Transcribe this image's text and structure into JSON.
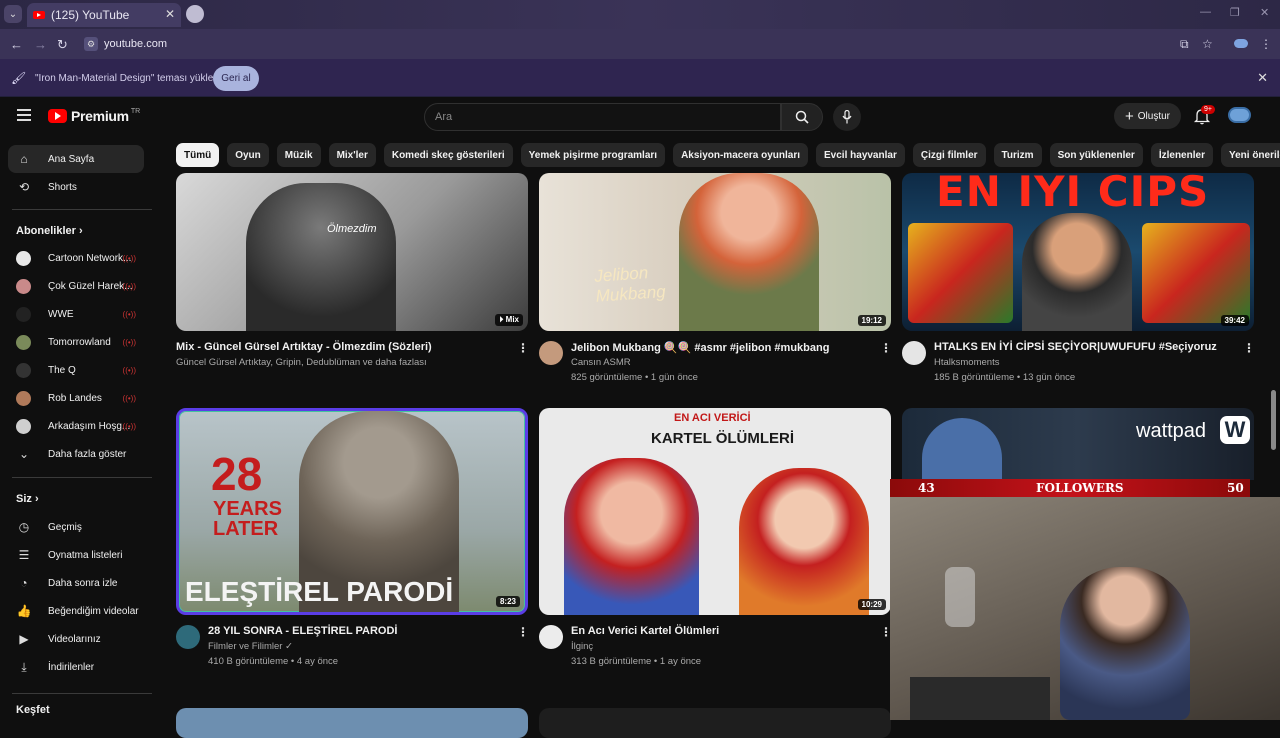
{
  "browser": {
    "tab_title": "(125) YouTube",
    "url": "youtube.com"
  },
  "theme_bar": {
    "message": "\"Iron Man-Material Design\" teması yüklendi",
    "undo_label": "Geri al"
  },
  "masthead": {
    "logo_text": "Premium",
    "logo_superscript": "TR",
    "search_placeholder": "Ara",
    "create_label": "Oluştur",
    "notification_count": "9+"
  },
  "chips": [
    "Tümü",
    "Oyun",
    "Müzik",
    "Mix'ler",
    "Komedi skeç gösterileri",
    "Yemek pişirme programları",
    "Aksiyon-macera oyunları",
    "Evcil hayvanlar",
    "Çizgi filmler",
    "Turizm",
    "Son yüklenenler",
    "İzlenenler",
    "Yeni öneriler"
  ],
  "sidebar": {
    "home": "Ana Sayfa",
    "shorts": "Shorts",
    "subscriptions_header": "Abonelikler",
    "subscriptions": [
      {
        "name": "Cartoon Network...",
        "color": "#e8e8e8"
      },
      {
        "name": "Çok Güzel Harek...",
        "color": "#c98a8a"
      },
      {
        "name": "WWE",
        "color": "#222222"
      },
      {
        "name": "Tomorrowland",
        "color": "#7a8a5a"
      },
      {
        "name": "The Q",
        "color": "#333333"
      },
      {
        "name": "Rob Landes",
        "color": "#b07a5a"
      },
      {
        "name": "Arkadaşım Hoşg...",
        "color": "#cfcfcf"
      }
    ],
    "show_more": "Daha fazla göster",
    "you_header": "Siz",
    "you_items": [
      "Geçmiş",
      "Oynatma listeleri",
      "Daha sonra izle",
      "Beğendiğim videolar",
      "Videolarınız",
      "İndirilenler"
    ],
    "explore_header": "Keşfet"
  },
  "videos": [
    {
      "title": "Mix - Güncel Gürsel Artıktay - Ölmezdim (Sözleri)",
      "channel": "Güncel Gürsel Artıktay, Gripin, Dedublüman ve daha fazlası",
      "meta": "",
      "badge": "Mix",
      "thumb_text": "Ölmezdim"
    },
    {
      "title": "Jelibon Mukbang 🍭🍭 #asmr #jelibon #mukbang",
      "channel": "Cansın ASMR",
      "meta": "825 görüntüleme • 1 gün önce",
      "badge": "19:12",
      "thumb_text": "Jelibon Mukbang"
    },
    {
      "title": "HTALKS EN İYİ CİPSİ SEÇİYOR|UWUFUFU #Seçiyoruz",
      "channel": "Htalksmoments",
      "meta": "185 B görüntüleme • 13 gün önce",
      "badge": "39:42",
      "thumb_text": "EN İYİ CİPS"
    },
    {
      "title": "28 YIL SONRA - ELEŞTİREL PARODİ",
      "channel": "Filmler ve Filimler ✓",
      "meta": "410 B görüntüleme • 4 ay önce",
      "badge": "8:23",
      "thumb_text_1": "28",
      "thumb_text_2": "YEARS LATER",
      "thumb_text_3": "ELEŞTİREL PARODİ"
    },
    {
      "title": "En Acı Verici Kartel Ölümleri",
      "channel": "İlginç",
      "meta": "313 B görüntüleme • 1 ay önce",
      "badge": "10:29",
      "thumb_text_1": "EN ACI VERİCİ",
      "thumb_text_2": "KARTEL ÖLÜMLERİ"
    }
  ],
  "overlay": {
    "wattpad": "wattpad",
    "followers_current": "43",
    "followers_label": "FOLLOWERS",
    "followers_goal": "50"
  }
}
